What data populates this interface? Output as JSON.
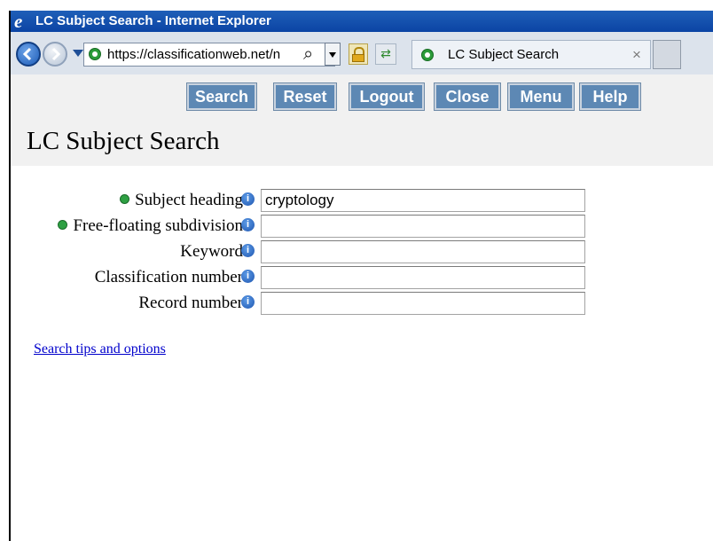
{
  "window": {
    "title": "LC Subject Search - Internet Explorer"
  },
  "browser": {
    "url": "https://classificationweb.net/n",
    "tab_title": "LC Subject Search",
    "tab_close": "×"
  },
  "toolbar": {
    "buttons": [
      "Search",
      "Reset",
      "Logout",
      "Close",
      "Menu",
      "Help"
    ]
  },
  "page": {
    "title": "LC Subject Search"
  },
  "form": {
    "fields": [
      {
        "label": "Subject heading",
        "value": "cryptology",
        "required_marker": true
      },
      {
        "label": "Free-floating subdivision",
        "value": "",
        "required_marker": true
      },
      {
        "label": "Keyword",
        "value": "",
        "required_marker": false
      },
      {
        "label": "Classification number",
        "value": "",
        "required_marker": false
      },
      {
        "label": "Record number",
        "value": "",
        "required_marker": false
      }
    ]
  },
  "links": {
    "search_tips": "Search tips and options"
  },
  "icons": {
    "info": "i",
    "ie_logo": "e",
    "search": "⌕",
    "refresh": "⇄"
  },
  "colors": {
    "title_bar": "#1f5fb8",
    "button_bg": "#5d88b4",
    "link": "#0000cc",
    "marker_green": "#2ea043"
  }
}
